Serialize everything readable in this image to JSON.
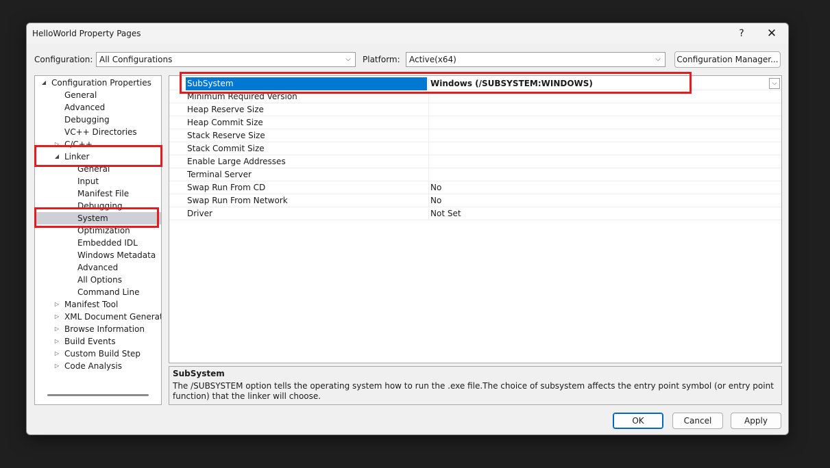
{
  "dialog": {
    "title": "HelloWorld Property Pages",
    "help_label": "?",
    "close_label": "✕"
  },
  "toolbar": {
    "configuration_label": "Configuration:",
    "configuration_value": "All Configurations",
    "platform_label": "Platform:",
    "platform_value": "Active(x64)",
    "config_manager_label": "Configuration Manager..."
  },
  "tree": {
    "items": [
      {
        "label": "Configuration Properties",
        "expander": "expanded"
      },
      {
        "label": "General",
        "expander": "none"
      },
      {
        "label": "Advanced",
        "expander": "none"
      },
      {
        "label": "Debugging",
        "expander": "none"
      },
      {
        "label": "VC++ Directories",
        "expander": "none"
      },
      {
        "label": "C/C++",
        "expander": "collapsed"
      },
      {
        "label": "Linker",
        "expander": "expanded"
      },
      {
        "label": "General",
        "expander": "none"
      },
      {
        "label": "Input",
        "expander": "none"
      },
      {
        "label": "Manifest File",
        "expander": "none"
      },
      {
        "label": "Debugging",
        "expander": "none"
      },
      {
        "label": "System",
        "expander": "none",
        "selected": true
      },
      {
        "label": "Optimization",
        "expander": "none"
      },
      {
        "label": "Embedded IDL",
        "expander": "none"
      },
      {
        "label": "Windows Metadata",
        "expander": "none"
      },
      {
        "label": "Advanced",
        "expander": "none"
      },
      {
        "label": "All Options",
        "expander": "none"
      },
      {
        "label": "Command Line",
        "expander": "none"
      },
      {
        "label": "Manifest Tool",
        "expander": "collapsed"
      },
      {
        "label": "XML Document Generator",
        "expander": "collapsed"
      },
      {
        "label": "Browse Information",
        "expander": "collapsed"
      },
      {
        "label": "Build Events",
        "expander": "collapsed"
      },
      {
        "label": "Custom Build Step",
        "expander": "collapsed"
      },
      {
        "label": "Code Analysis",
        "expander": "collapsed"
      }
    ]
  },
  "grid": {
    "rows": [
      {
        "name": "SubSystem",
        "value": "Windows (/SUBSYSTEM:WINDOWS)",
        "selected": true
      },
      {
        "name": "Minimum Required Version",
        "value": ""
      },
      {
        "name": "Heap Reserve Size",
        "value": ""
      },
      {
        "name": "Heap Commit Size",
        "value": ""
      },
      {
        "name": "Stack Reserve Size",
        "value": ""
      },
      {
        "name": "Stack Commit Size",
        "value": ""
      },
      {
        "name": "Enable Large Addresses",
        "value": ""
      },
      {
        "name": "Terminal Server",
        "value": ""
      },
      {
        "name": "Swap Run From CD",
        "value": "No"
      },
      {
        "name": "Swap Run From Network",
        "value": "No"
      },
      {
        "name": "Driver",
        "value": "Not Set"
      }
    ]
  },
  "description": {
    "title": "SubSystem",
    "text": "The /SUBSYSTEM option tells the operating system how to run the .exe file.The choice of subsystem affects the entry point symbol (or entry point function) that the linker will choose."
  },
  "buttons": {
    "ok": "OK",
    "cancel": "Cancel",
    "apply": "Apply"
  },
  "colors": {
    "highlight": "#e01e22",
    "selection": "#0078d4"
  }
}
